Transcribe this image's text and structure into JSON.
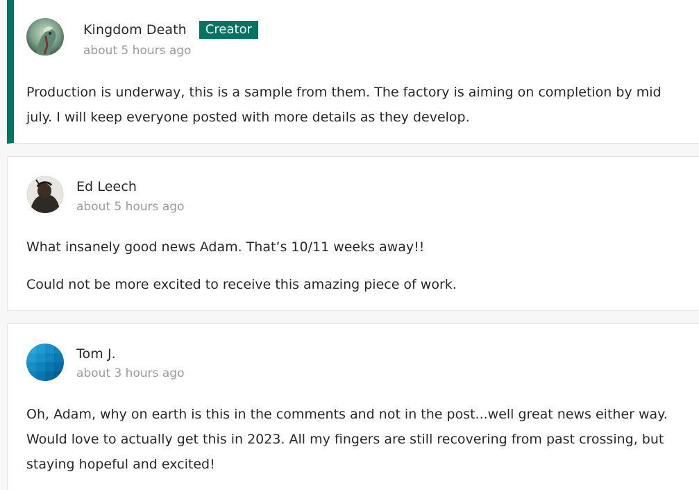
{
  "comments": [
    {
      "author": "Kingdom Death",
      "badge": "Creator",
      "time": "about 5 hours ago",
      "paragraphs": [
        "Production is underway, this is a sample from them. The factory is aiming on completion by mid july. I will keep everyone posted with more details as they develop."
      ]
    },
    {
      "author": "Ed Leech",
      "time": "about 5 hours ago",
      "paragraphs": [
        "What insanely good news Adam. That’s 10/11 weeks away!!",
        "Could not be more excited to receive this amazing piece of work."
      ]
    },
    {
      "author": "Tom J.",
      "time": "about 3 hours ago",
      "paragraphs": [
        "Oh, Adam, why on earth is this in the comments and not in the post...well great news either way. Would love to actually get this in 2023. All my fingers are still recovering from past crossing, but staying hopeful and excited!"
      ]
    }
  ],
  "colors": {
    "creator_accent": "#037362",
    "timestamp": "#9b9b9b",
    "text": "#282828"
  }
}
